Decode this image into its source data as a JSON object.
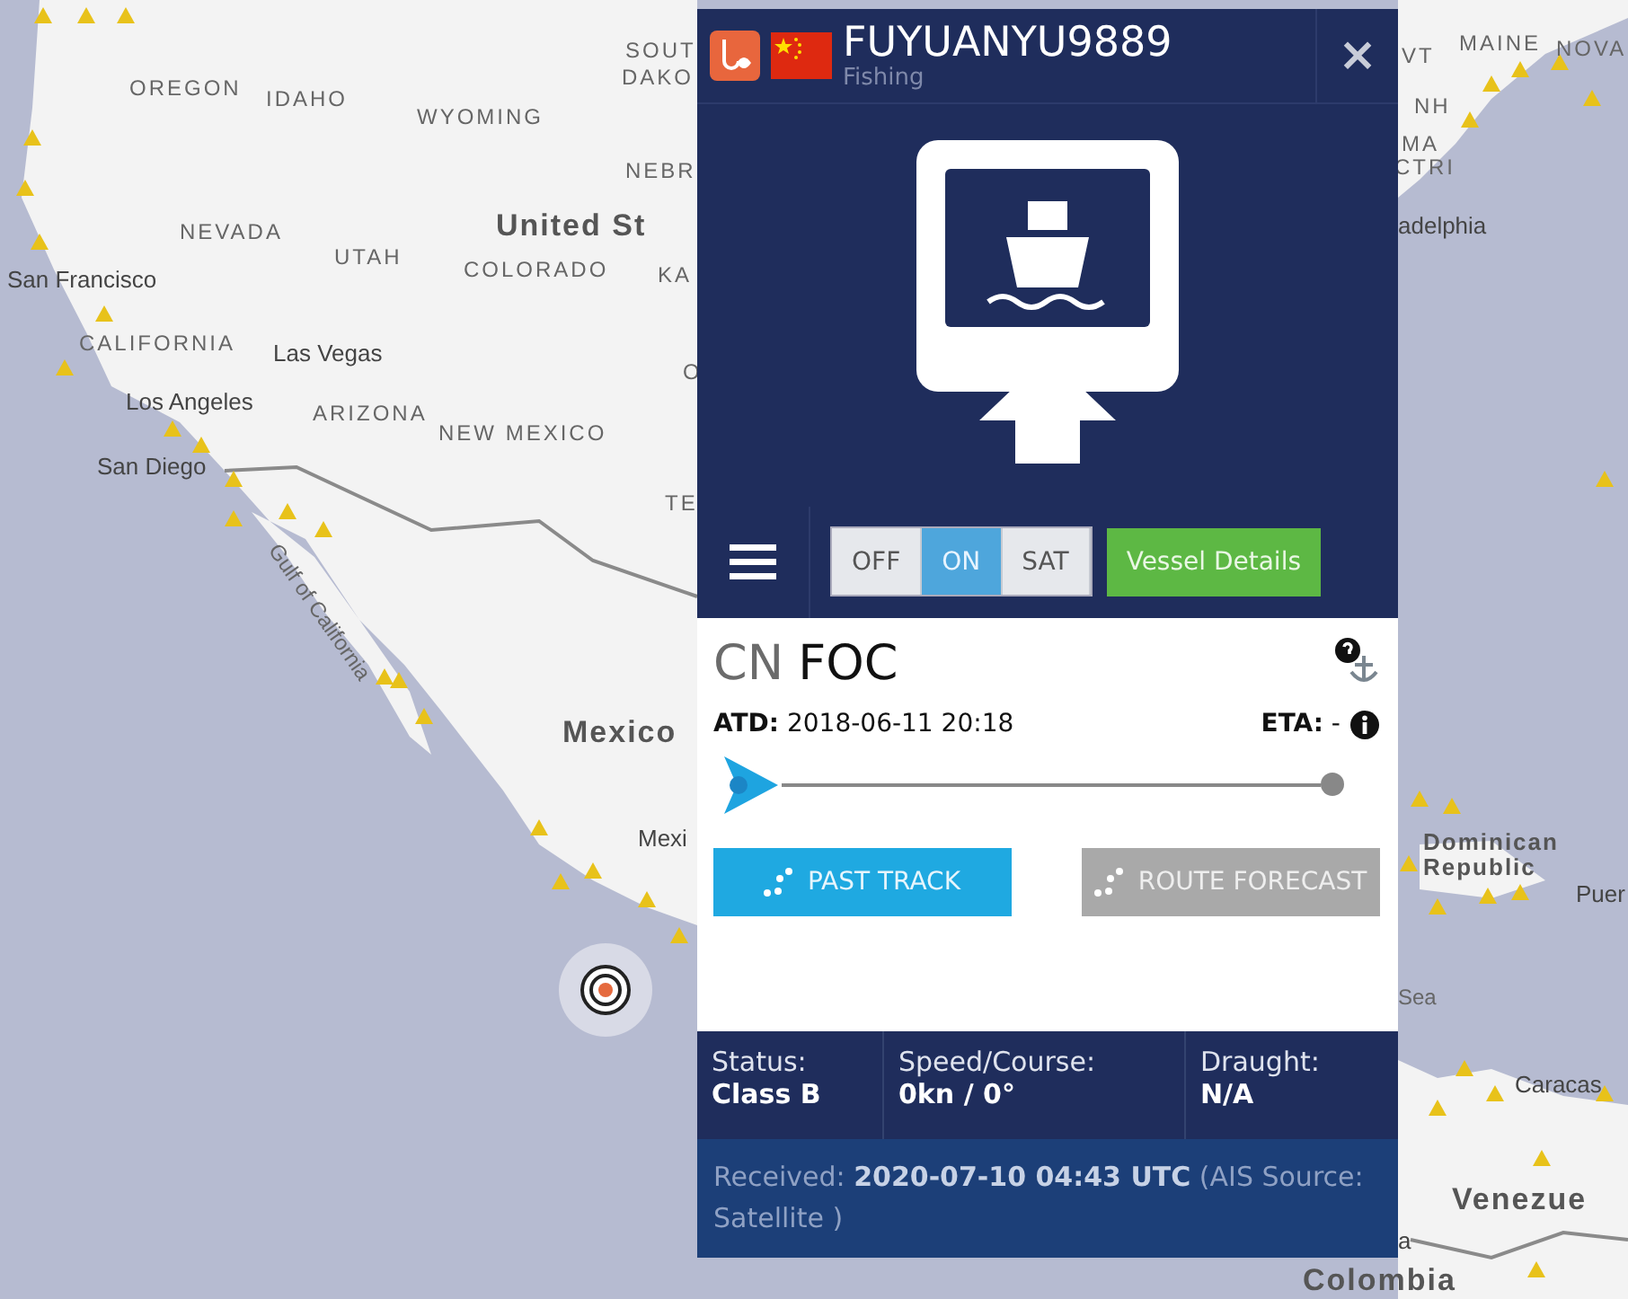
{
  "map": {
    "labels": [
      {
        "text": "SOUT",
        "kind": "state"
      },
      {
        "text": "VT",
        "kind": "state"
      },
      {
        "text": "MAINE",
        "kind": "state"
      },
      {
        "text": "NOVA",
        "kind": "state"
      },
      {
        "text": "DAKO",
        "kind": "state"
      },
      {
        "text": "OREGON",
        "kind": "state"
      },
      {
        "text": "IDAHO",
        "kind": "state"
      },
      {
        "text": "WYOMING",
        "kind": "state"
      },
      {
        "text": "NH",
        "kind": "state"
      },
      {
        "text": "MA",
        "kind": "state"
      },
      {
        "text": "NEBR",
        "kind": "state"
      },
      {
        "text": "CTRI",
        "kind": "state"
      },
      {
        "text": "NEVADA",
        "kind": "state"
      },
      {
        "text": "United St",
        "kind": "country"
      },
      {
        "text": "adelphia",
        "kind": "city"
      },
      {
        "text": "San Francisco",
        "kind": "city"
      },
      {
        "text": "UTAH",
        "kind": "state"
      },
      {
        "text": "COLORADO",
        "kind": "state"
      },
      {
        "text": "KA",
        "kind": "state"
      },
      {
        "text": "CALIFORNIA",
        "kind": "state"
      },
      {
        "text": "Las Vegas",
        "kind": "city"
      },
      {
        "text": "O",
        "kind": "state"
      },
      {
        "text": "Los Angeles",
        "kind": "city"
      },
      {
        "text": "ARIZONA",
        "kind": "state"
      },
      {
        "text": "NEW MEXICO",
        "kind": "state"
      },
      {
        "text": "San Diego",
        "kind": "city"
      },
      {
        "text": "TE",
        "kind": "state"
      },
      {
        "text": "Gulf of California",
        "kind": "water"
      },
      {
        "text": "Mexico",
        "kind": "country"
      },
      {
        "text": "Mexi",
        "kind": "city"
      },
      {
        "text": "Dominican Republic",
        "kind": "country"
      },
      {
        "text": "Puer",
        "kind": "city"
      },
      {
        "text": "Sea",
        "kind": "water"
      },
      {
        "text": "Caracas",
        "kind": "city"
      },
      {
        "text": "Venezue",
        "kind": "country"
      },
      {
        "text": "a",
        "kind": "city"
      },
      {
        "text": "Colombia",
        "kind": "country"
      }
    ]
  },
  "vessel": {
    "name": "FUYUANYU9889",
    "type": "Fishing",
    "close": "×"
  },
  "toolbar": {
    "modes": [
      {
        "label": "OFF",
        "selected": false
      },
      {
        "label": "ON",
        "selected": true
      },
      {
        "label": "SAT",
        "selected": false
      }
    ],
    "details_button": "Vessel Details"
  },
  "route": {
    "flag_code": "CN",
    "port": "FOC",
    "atd_label": "ATD:",
    "atd_value": "2018-06-11 20:18",
    "eta_label": "ETA:",
    "eta_value": "-",
    "level": 0
  },
  "track_buttons": [
    {
      "label": "PAST TRACK",
      "disabled": false
    },
    {
      "label": "ROUTE FORECAST",
      "disabled": true
    }
  ],
  "stats": [
    {
      "label": "Status:",
      "value": "Class B"
    },
    {
      "label": "Speed/Course:",
      "value": "0kn / 0°"
    },
    {
      "label": "Draught:",
      "value": "N/A"
    }
  ],
  "received": "Received: **2020-07-10 04:43 UTC** (AIS Source: Satellite )"
}
